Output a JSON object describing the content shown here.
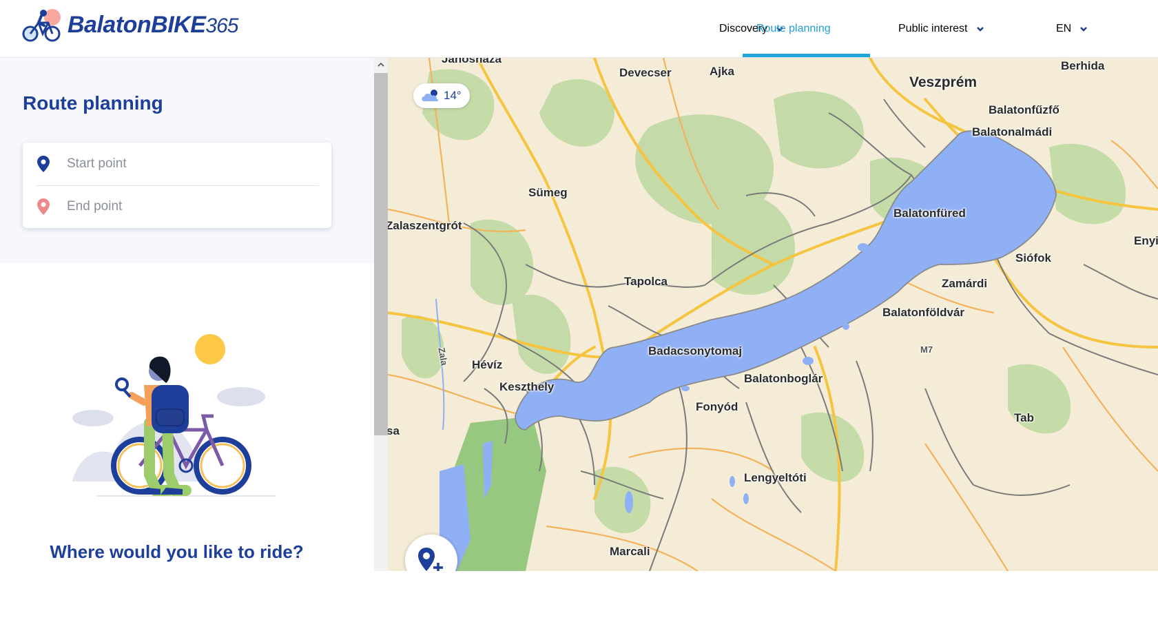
{
  "header": {
    "logo_text": "BalatonBIKE",
    "logo_number": "365",
    "nav": [
      {
        "label": "Discovery",
        "has_dropdown": true,
        "active": false
      },
      {
        "label": "Route planning",
        "has_dropdown": false,
        "active": true
      },
      {
        "label": "Public interest",
        "has_dropdown": true,
        "active": false
      },
      {
        "label": "EN",
        "has_dropdown": true,
        "active": false
      }
    ]
  },
  "sidebar": {
    "title": "Route planning",
    "start_placeholder": "Start point",
    "end_placeholder": "End point",
    "prompt": "Where would you like to ride?"
  },
  "map": {
    "weather": {
      "icon": "cloud-icon",
      "temperature": "14°"
    },
    "labels": {
      "janoshaza": "Jánosháza",
      "devecser": "Devecser",
      "ajka": "Ajka",
      "veszprem": "Veszprém",
      "berhida": "Berhida",
      "balatonfuzfo": "Balatonfűzfő",
      "balatonalmadi": "Balatonalmádi",
      "sumeg": "Sümeg",
      "zalaszentgrot": "Zalaszentgrót",
      "balatonfured": "Balatonfüred",
      "enyi": "Enyi",
      "siofok": "Siófok",
      "tapolca": "Tapolca",
      "zamardi": "Zamárdi",
      "balatonfoldvar": "Balatonföldvár",
      "badacsonytomaj": "Badacsonytomaj",
      "m7": "M7",
      "zala": "Zala",
      "heviz": "Hévíz",
      "balatonboglar": "Balatonboglár",
      "keszthely": "Keszthely",
      "fonyod": "Fonyód",
      "tab": "Tab",
      "sa": "sa",
      "lengyeltoti": "Lengyeltóti",
      "marcali": "Marcali"
    },
    "add_poi_icon": "add-location-icon"
  },
  "colors": {
    "brand": "#1d3f9a",
    "accent": "#1fa4dc",
    "lake": "#8fb0f5",
    "map_background": "#f4ecd6",
    "forest": "#bcd8a0",
    "road_major": "#f5c542",
    "road_minor": "#f3b25c",
    "bike_route": "#7a7a7a"
  }
}
